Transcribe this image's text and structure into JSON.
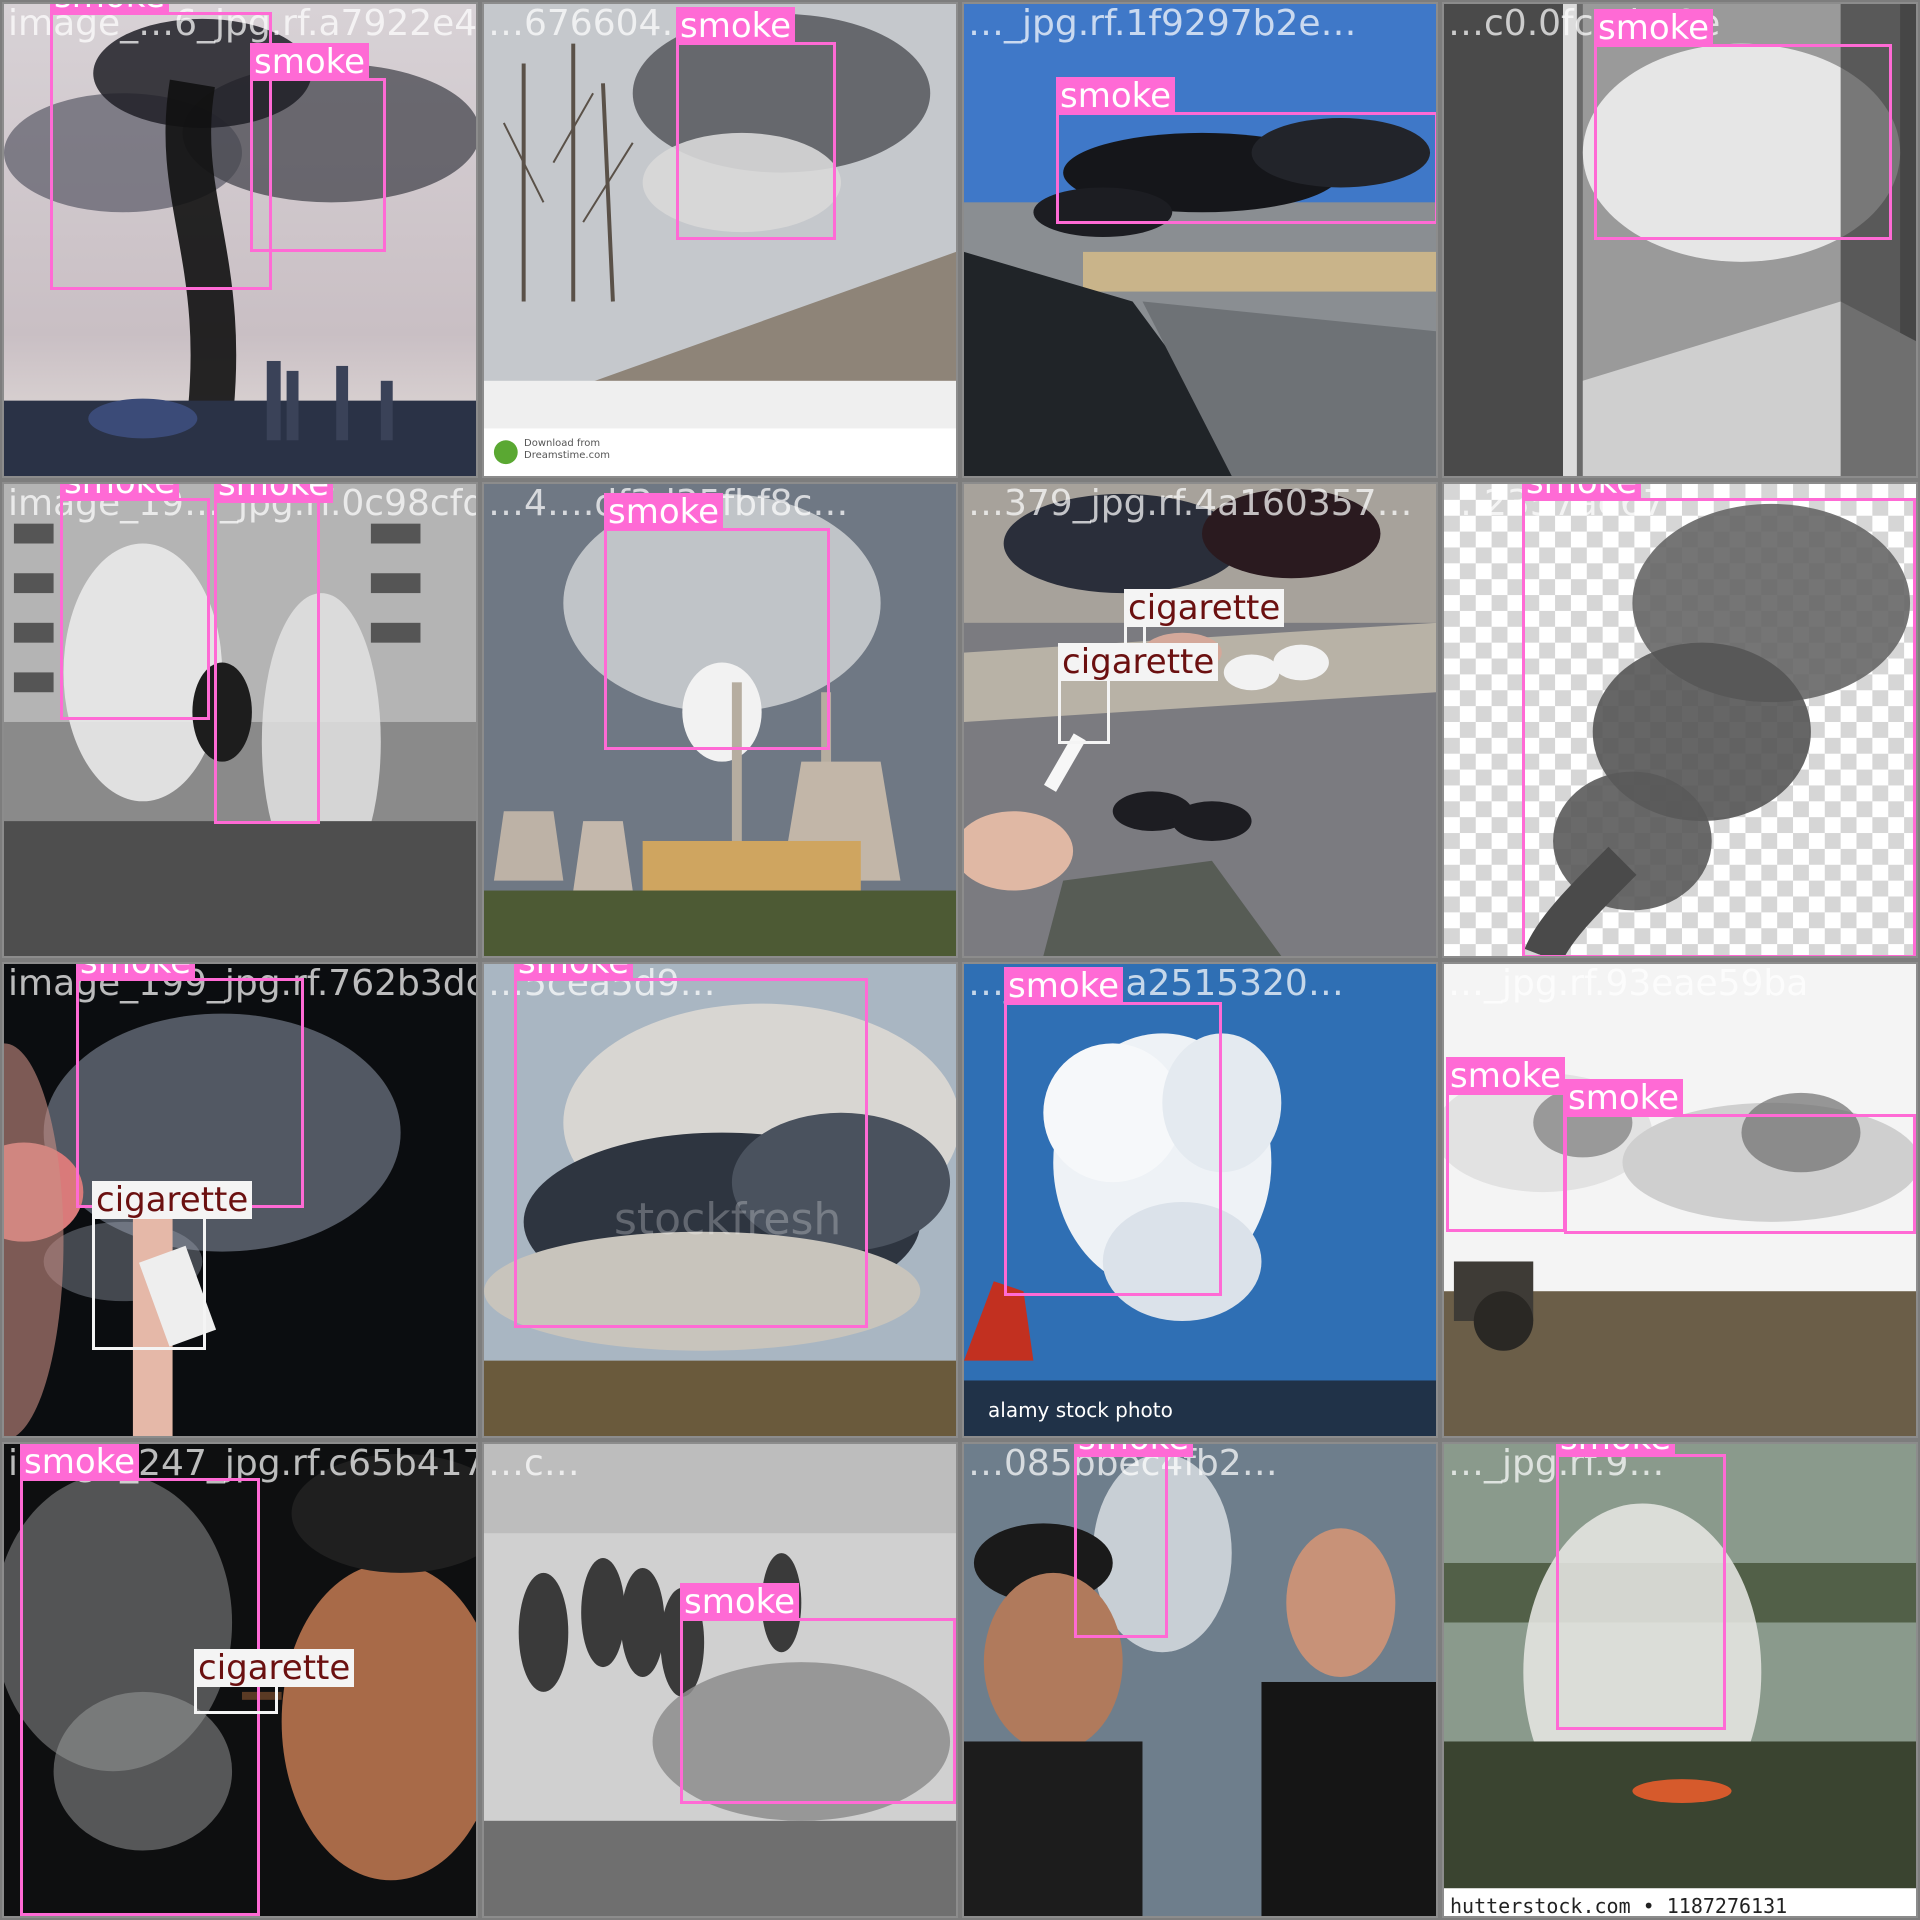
{
  "grid": {
    "rows": 4,
    "cols": 4
  },
  "colors": {
    "smoke": "#ff6ad5",
    "cigarette": "#f4f4f4",
    "cigarette_text": "#6b1010"
  },
  "tiles": [
    {
      "filename": "image_…6_jpg.rf.a7922e4…",
      "scene": "dark-plume-city",
      "boxes": [
        {
          "label": "smoke"
        },
        {
          "label": "smoke"
        }
      ]
    },
    {
      "filename": "…676604…",
      "scene": "factory-wall-smoke",
      "boxes": [
        {
          "label": "smoke"
        }
      ]
    },
    {
      "filename": "…_jpg.rf.1f9297b2e…",
      "scene": "black-smoke-highway",
      "boxes": [
        {
          "label": "smoke"
        }
      ]
    },
    {
      "filename": "…c0.0fc5d…9e",
      "scene": "vapor-window",
      "boxes": [
        {
          "label": "smoke"
        }
      ]
    },
    {
      "filename": "image_19…_jpg.rf.0c98cfdd5…",
      "scene": "steam-street-bw",
      "boxes": [
        {
          "label": "smoke"
        },
        {
          "label": "smoke"
        }
      ]
    },
    {
      "filename": "…4….df3d35fbf8c…",
      "scene": "power-plant",
      "boxes": [
        {
          "label": "smoke"
        }
      ]
    },
    {
      "filename": "…379_jpg.rf.4a160357…",
      "scene": "cigarette-ground",
      "boxes": [
        {
          "label": "cigarette"
        },
        {
          "label": "cigarette"
        }
      ]
    },
    {
      "filename": "…2357ae67",
      "scene": "plume-transparent",
      "boxes": [
        {
          "label": "smoke"
        }
      ]
    },
    {
      "filename": "image_199_jpg.rf.762b3dcf5…",
      "scene": "lips-cigarette",
      "boxes": [
        {
          "label": "smoke"
        },
        {
          "label": "cigarette"
        }
      ]
    },
    {
      "filename": "…5cea5d9…",
      "scene": "stockfresh-fire",
      "boxes": [
        {
          "label": "smoke"
        }
      ]
    },
    {
      "filename": "…_jpg.rf.a2515320…",
      "scene": "alamy-cloud",
      "boxes": [
        {
          "label": "smoke"
        }
      ]
    },
    {
      "filename": "…_jpg.rf.93eae59ba",
      "scene": "tractor-field",
      "boxes": [
        {
          "label": "smoke"
        },
        {
          "label": "smoke"
        }
      ]
    },
    {
      "filename": "image_247_jpg.rf.c65b4173…",
      "scene": "man-cigar",
      "boxes": [
        {
          "label": "smoke"
        },
        {
          "label": "cigarette"
        }
      ]
    },
    {
      "filename": "…c…",
      "scene": "people-smoke-bw",
      "boxes": [
        {
          "label": "smoke"
        }
      ]
    },
    {
      "filename": "…085bbec4fb2…",
      "scene": "men-crowd",
      "boxes": [
        {
          "label": "smoke"
        }
      ]
    },
    {
      "filename": "…_jpg.rf.9…",
      "scene": "grass-fire",
      "boxes": [
        {
          "label": "smoke"
        }
      ]
    }
  ],
  "watermarks": {
    "dreamstime_line1": "Download from",
    "dreamstime_line2": "Dreamstime.com",
    "alamy": "alamy stock photo",
    "shutterstock": "hutterstock.com • 1187276131",
    "stockfresh": "stockfresh"
  }
}
